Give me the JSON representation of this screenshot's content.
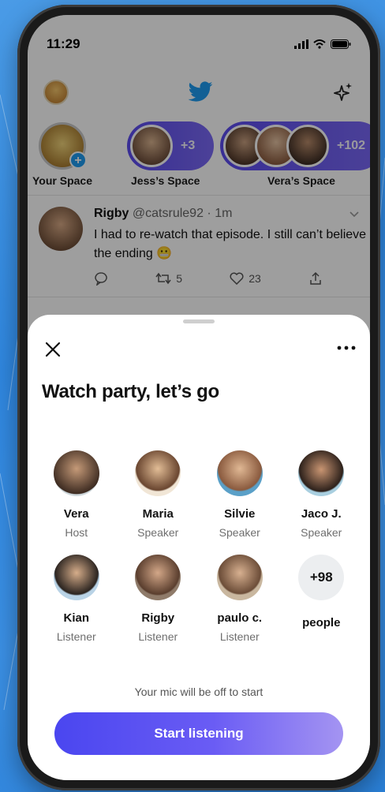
{
  "status": {
    "time": "11:29"
  },
  "spaces": [
    {
      "label": "Your Space"
    },
    {
      "label": "Jess’s Space",
      "count": "+3"
    },
    {
      "label": "Vera’s Space",
      "count": "+102"
    }
  ],
  "tweet": {
    "name": "Rigby",
    "handle": "@catsrule92 · 1m",
    "text": "I had to re-watch that episode. I still can’t believe the ending",
    "retweets": "5",
    "likes": "23"
  },
  "sheet": {
    "title": "Watch party, let’s go",
    "participants": [
      {
        "name": "Vera",
        "role": "Host"
      },
      {
        "name": "Maria",
        "role": "Speaker"
      },
      {
        "name": "Silvie",
        "role": "Speaker"
      },
      {
        "name": "Jaco J.",
        "role": "Speaker"
      },
      {
        "name": "Kian",
        "role": "Listener"
      },
      {
        "name": "Rigby",
        "role": "Listener"
      },
      {
        "name": "paulo c.",
        "role": "Listener"
      }
    ],
    "more_count": "+98",
    "more_label": "people",
    "mic_note": "Your mic will be off to start",
    "start_label": "Start listening"
  },
  "colors": {
    "accent": "#4a46f0",
    "twitter_blue": "#1d9bf0",
    "pill": "#5b4bf0"
  }
}
